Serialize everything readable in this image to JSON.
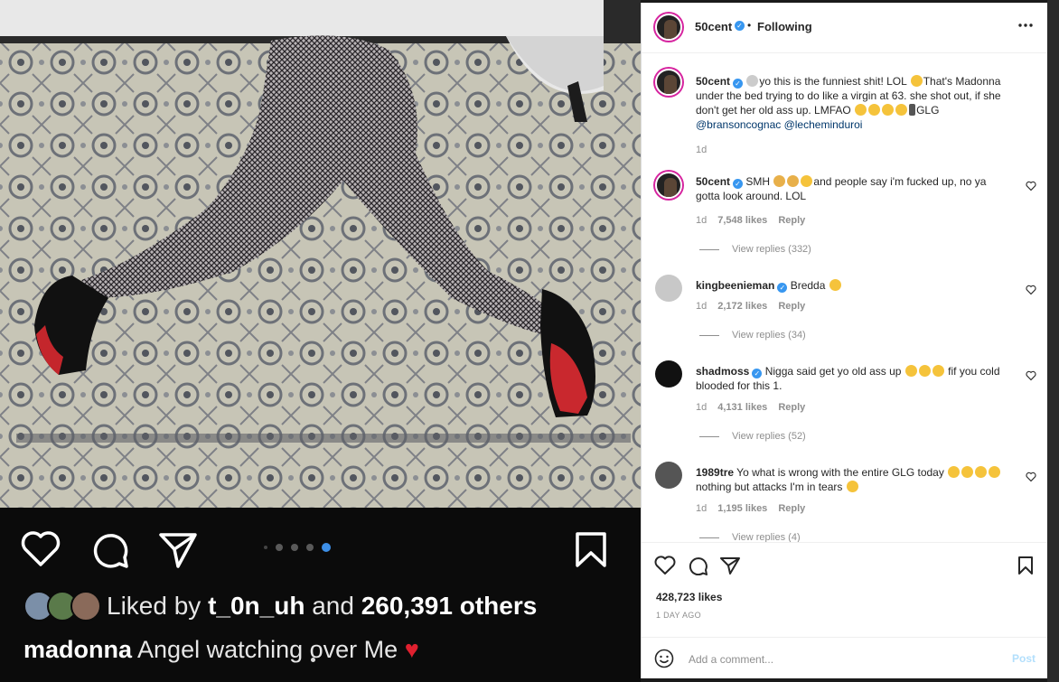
{
  "post": {
    "liked_by_prefix": "Liked by",
    "liked_by_user": "t_0n_uh",
    "liked_by_mid": "and",
    "liked_by_count": "260,391 others",
    "caption_user": "madonna",
    "caption_text": "Angel watching over Me",
    "carousel_active_index": 4,
    "carousel_count": 5
  },
  "header": {
    "username": "50cent",
    "separator": "•",
    "follow_status": "Following",
    "more_icon": "more-horizontal-icon"
  },
  "caption": {
    "username": "50cent",
    "text_1": "yo this is the funniest shit! LOL",
    "text_2": "That's Madonna under the bed trying to do like a virgin at 63. she shot out, if she don't get her old ass up. LMFAO",
    "text_3": "GLG",
    "mentions": "@bransoncognac @lecheminduroi",
    "age": "1d"
  },
  "comments": [
    {
      "username": "50cent",
      "text": "SMH",
      "text_2": "and people say i'm fucked up, no ya gotta look around. LOL",
      "age": "1d",
      "likes": "7,548 likes",
      "reply": "Reply",
      "view_replies": "View replies (332)"
    },
    {
      "username": "kingbeenieman",
      "text": "Bredda",
      "text_2": "",
      "age": "1d",
      "likes": "2,172 likes",
      "reply": "Reply",
      "view_replies": "View replies (34)"
    },
    {
      "username": "shadmoss",
      "text": "Nigga said get yo old ass up",
      "text_2": "fif you cold blooded for this 1.",
      "age": "1d",
      "likes": "4,131 likes",
      "reply": "Reply",
      "view_replies": "View replies (52)"
    },
    {
      "username": "1989tre",
      "text": "Yo what is wrong with the entire GLG today",
      "text_2": "nothing but attacks I'm in tears",
      "age": "1d",
      "likes": "1,195 likes",
      "reply": "Reply",
      "view_replies": "View replies (4)"
    }
  ],
  "footer": {
    "likes": "428,723 likes",
    "age": "1 DAY AGO",
    "comment_placeholder": "Add a comment...",
    "post_label": "Post"
  },
  "colors": {
    "verified": "#3897f0",
    "link": "#00376b",
    "muted": "#8e8e8e",
    "post_disabled": "#b2dffc",
    "carousel_active": "#3d8fe8",
    "heart": "#e0202f"
  }
}
